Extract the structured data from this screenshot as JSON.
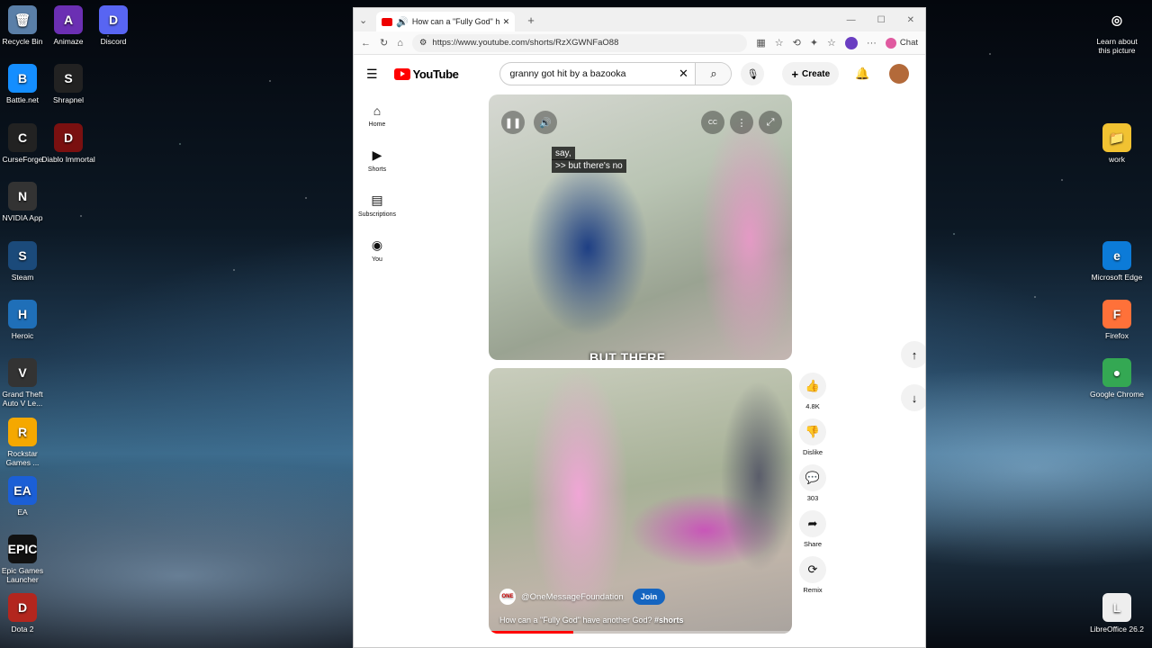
{
  "desktop": {
    "left_icons": [
      {
        "label": "Recycle Bin",
        "glyph": "🗑",
        "color": "#5a7fa8"
      },
      {
        "label": "Animaze",
        "glyph": "A",
        "color": "#6b2fb3"
      },
      {
        "label": "Discord",
        "glyph": "D",
        "color": "#5865f2"
      },
      {
        "label": "Battle.net",
        "glyph": "B",
        "color": "#148eff"
      },
      {
        "label": "Shrapnel",
        "glyph": "S",
        "color": "#222222"
      },
      {
        "label": "CurseForge",
        "glyph": "C",
        "color": "#222222"
      },
      {
        "label": "Diablo Immortal",
        "glyph": "D",
        "color": "#7a1010"
      },
      {
        "label": "NVIDIA App",
        "glyph": "N",
        "color": "#333333"
      },
      {
        "label": "Steam",
        "glyph": "S",
        "color": "#1b4a7a"
      },
      {
        "label": "Heroic",
        "glyph": "H",
        "color": "#1f6fb8"
      },
      {
        "label": "Grand Theft Auto V Le...",
        "glyph": "V",
        "color": "#333333"
      },
      {
        "label": "Rockstar Games ...",
        "glyph": "R",
        "color": "#f5a800"
      },
      {
        "label": "EA",
        "glyph": "EA",
        "color": "#1b5fd6"
      },
      {
        "label": "Epic Games Launcher",
        "glyph": "EPIC",
        "color": "#111111"
      },
      {
        "label": "Dota 2",
        "glyph": "D",
        "color": "#b3261e"
      }
    ],
    "right_icons": [
      {
        "label": "Learn about this picture",
        "glyph": "◎",
        "color": "transparent"
      },
      {
        "label": "work",
        "glyph": "📁",
        "color": "#f1c232"
      },
      {
        "label": "Microsoft Edge",
        "glyph": "e",
        "color": "#0c7bd8"
      },
      {
        "label": "Firefox",
        "glyph": "F",
        "color": "#ff7139"
      },
      {
        "label": "Google Chrome",
        "glyph": "●",
        "color": "#34a853"
      },
      {
        "label": "LibreOffice 26.2",
        "glyph": "L",
        "color": "#eeeeee"
      }
    ]
  },
  "browser": {
    "tab_title": "How can a \"Fully God\" have another God? #shorts",
    "new_tab_icon": "+",
    "url": "https://www.youtube.com/shorts/RzXGWNFaO88",
    "chat_label": "Chat"
  },
  "youtube": {
    "logo_text": "YouTube",
    "search_query": "granny got hit by a bazooka",
    "create_label": "Create",
    "sidebar": [
      {
        "label": "Home",
        "icon": "⌂"
      },
      {
        "label": "Shorts",
        "icon": "▶"
      },
      {
        "label": "Subscriptions",
        "icon": "▤"
      },
      {
        "label": "You",
        "icon": "◉"
      }
    ],
    "short1": {
      "caption_line1": "say,",
      "caption_line2": ">> but there's no",
      "overlay_text": "BUT THERE"
    },
    "short2": {
      "channel": "@OneMessageFoundation",
      "channel_avatar": "ONE",
      "join_label": "Join",
      "title_text": "How can a \"Fully God\" have another  God?",
      "hashtag": "#shorts",
      "progress": 0.28
    },
    "actions": [
      {
        "label": "4.8K",
        "icon": "👍"
      },
      {
        "label": "Dislike",
        "icon": "👎"
      },
      {
        "label": "303",
        "icon": "💬"
      },
      {
        "label": "Share",
        "icon": "➦"
      },
      {
        "label": "Remix",
        "icon": "⟳"
      }
    ]
  }
}
